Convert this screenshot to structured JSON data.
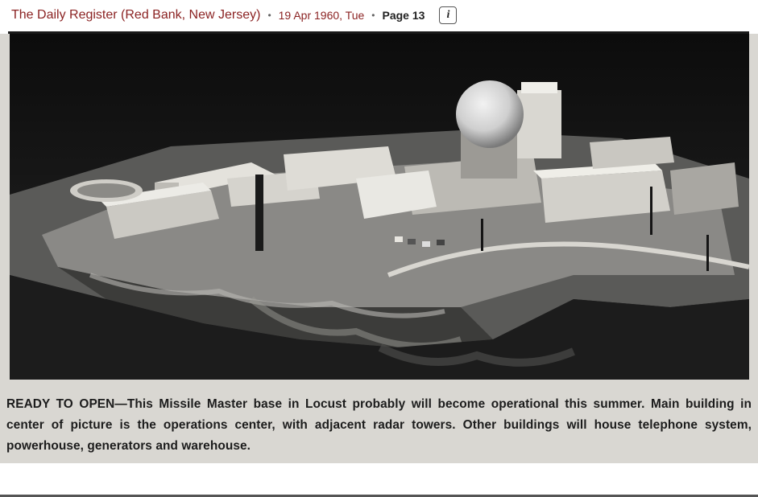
{
  "header": {
    "publication": "The Daily Register (Red Bank, New Jersey)",
    "date": "19 Apr 1960, Tue",
    "page": "Page 13",
    "separator": "•",
    "info_icon": "info-icon",
    "info_glyph": "i"
  },
  "photo": {
    "description_icon": "newspaper-photograph"
  },
  "caption": {
    "lead": "READY TO OPEN",
    "dash": "—",
    "body": "This Missile Master base in Locust probably will become operational this summer. Main building in center of picture is the operations center, with adjacent radar towers. Other buildings will house telephone system, powerhouse, generators and warehouse."
  }
}
